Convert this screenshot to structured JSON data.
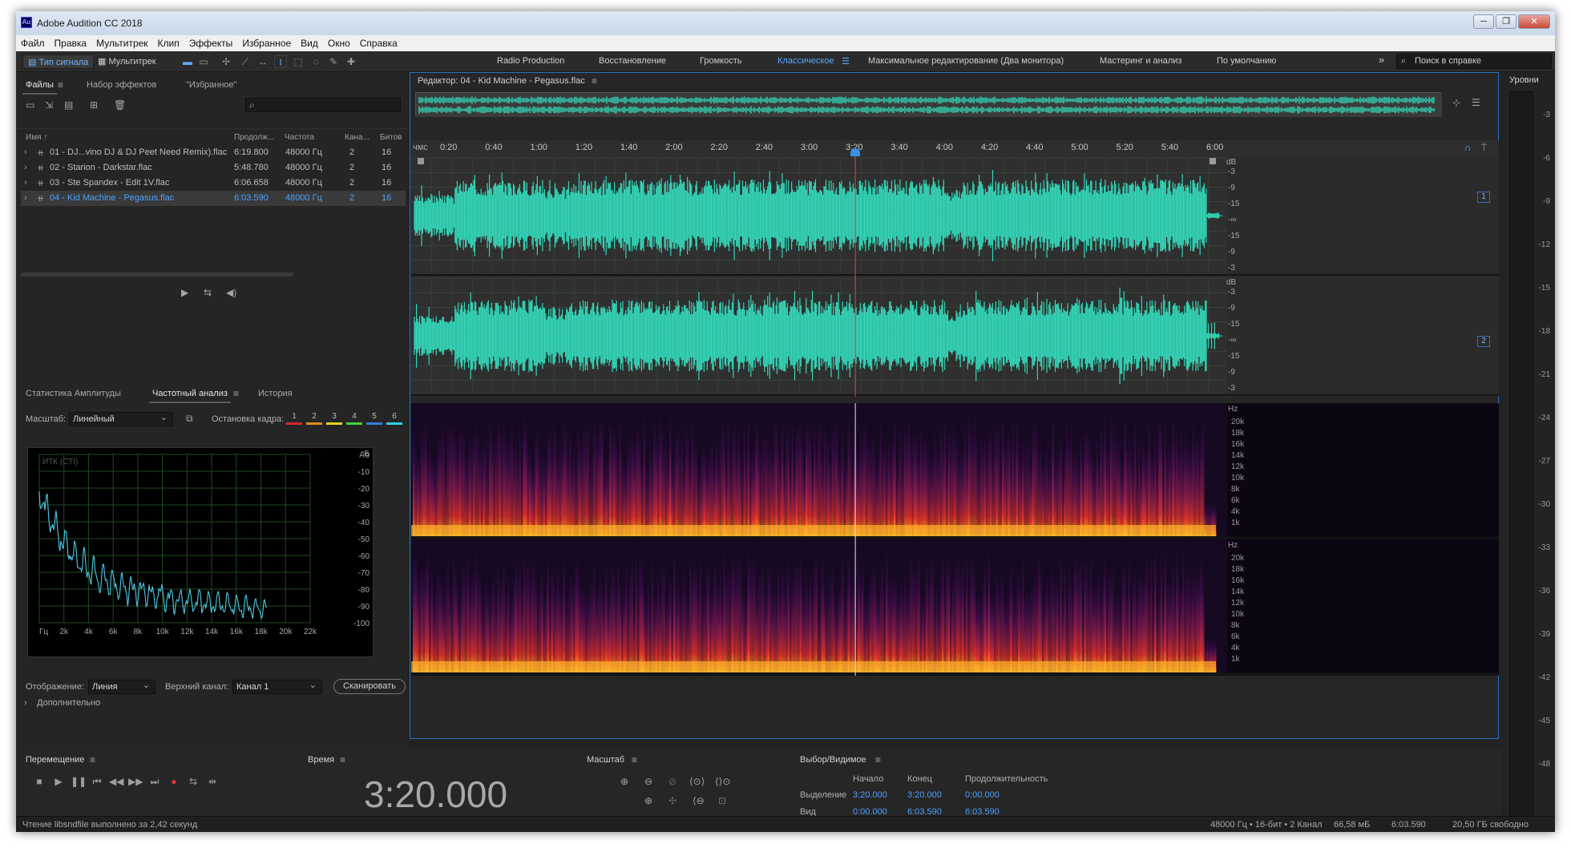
{
  "window": {
    "title": "Adobe Audition CC 2018",
    "app_icon": "Au",
    "buttons": [
      "─",
      "❐",
      "✕"
    ]
  },
  "menu": [
    "Файл",
    "Правка",
    "Мультитрек",
    "Клип",
    "Эффекты",
    "Избранное",
    "Вид",
    "Окно",
    "Справка"
  ],
  "toolbar": {
    "waveform_label": "Тип сигнала",
    "multitrack_label": "Мультитрек",
    "workspaces": [
      "Radio Production",
      "Восстановление",
      "Громкость",
      "Классическое",
      "Максимальное редактирование (Два монитора)",
      "Мастеринг и анализ",
      "По умолчанию"
    ],
    "active_workspace": 3,
    "more": "»",
    "help_placeholder": "Поиск в справке"
  },
  "files_panel": {
    "tabs": [
      "Файлы",
      "Набор эффектов",
      "\"Избранное\""
    ],
    "columns": [
      "Имя ↑",
      "Продолж...",
      "Частота",
      "Кана...",
      "Битов"
    ],
    "rows": [
      {
        "name": "01 - DJ...vino DJ & DJ Peet Need Remix).flac",
        "duration": "6:19.800",
        "rate": "48000 Гц",
        "channels": "2",
        "bits": "16"
      },
      {
        "name": "02 - Starion - Darkstar.flac",
        "duration": "5:48.780",
        "rate": "48000 Гц",
        "channels": "2",
        "bits": "16"
      },
      {
        "name": "03 - Ste Spandex - Edit 1V.flac",
        "duration": "6:06.658",
        "rate": "48000 Гц",
        "channels": "2",
        "bits": "16"
      },
      {
        "name": "04 - Kid Machine - Pegasus.flac",
        "duration": "6:03.590",
        "rate": "48000 Гц",
        "channels": "2",
        "bits": "16"
      }
    ],
    "selected_row": 3
  },
  "analysis_panel": {
    "tabs": [
      "Статистика Амплитуды",
      "Частотный анализ",
      "История"
    ],
    "scale_label": "Масштаб:",
    "scale_value": "Линейный",
    "freeze_label": "Остановка кадра:",
    "freeze_buttons": [
      "1",
      "2",
      "3",
      "4",
      "5",
      "6"
    ],
    "freeze_colors": [
      "#d22828",
      "#e08a1e",
      "#e0d21e",
      "#3fd23f",
      "#2f7fe0",
      "#2fd0e0"
    ],
    "graph_label": "ИТК (СТI)",
    "db_unit": "дБ",
    "db_ticks": [
      "0",
      "-10",
      "-20",
      "-30",
      "-40",
      "-50",
      "-60",
      "-70",
      "-80",
      "-90",
      "-100"
    ],
    "hz_ticks": [
      "Гц",
      "2k",
      "4k",
      "6k",
      "8k",
      "10k",
      "12k",
      "14k",
      "16k",
      "18k",
      "20k",
      "22k"
    ],
    "display_label": "Отображение:",
    "display_value": "Линия",
    "channel_label": "Верхний канал:",
    "channel_value": "Канал 1",
    "scan_button": "Сканировать",
    "advanced_label": "Дополнительно",
    "curve_color": "#4ec8e8"
  },
  "editor": {
    "title": "Редактор: 04 - Kid Machine - Pegasus.flac",
    "ruler_unit": "чмс",
    "ruler_ticks": [
      "0:20",
      "0:40",
      "1:00",
      "1:20",
      "1:40",
      "2:00",
      "2:20",
      "2:40",
      "3:00",
      "3:20",
      "3:40",
      "4:00",
      "4:20",
      "4:40",
      "5:00",
      "5:20",
      "5:40",
      "6:00"
    ],
    "playhead_time": "3:20.000",
    "wave_color": "#33d6b8",
    "db_unit": "dB",
    "db_ticks": [
      "-3",
      "-9",
      "-15",
      "-∞",
      "-15",
      "-9",
      "-3"
    ],
    "hz_unit": "Hz",
    "hz_ticks": [
      "20k",
      "18k",
      "16k",
      "14k",
      "12k",
      "10k",
      "8k",
      "6k",
      "4k",
      "1k"
    ],
    "channels": [
      "1",
      "2"
    ]
  },
  "levels": {
    "title": "Уровни",
    "ticks": [
      "-3",
      "-6",
      "-9",
      "-12",
      "-15",
      "-18",
      "-21",
      "-24",
      "-27",
      "-30",
      "-33",
      "-36",
      "-39",
      "-42",
      "-45",
      "-48"
    ]
  },
  "transport": {
    "title": "Перемещение",
    "buttons": [
      "■",
      "▶",
      "❚❚",
      "⏮",
      "◀◀",
      "▶▶",
      "⏭",
      "●",
      "⇆",
      "⇹"
    ]
  },
  "time": {
    "title": "Время",
    "value": "3:20.000"
  },
  "zoom": {
    "title": "Масштаб"
  },
  "selection": {
    "title": "Выбор/Видимое",
    "columns": [
      "Начало",
      "Конец",
      "Продолжительность"
    ],
    "rows": [
      {
        "label": "Выделение",
        "start": "3:20.000",
        "end": "3:20.000",
        "duration": "0:00.000"
      },
      {
        "label": "Вид",
        "start": "0:00.000",
        "end": "6:03.590",
        "duration": "6:03.590"
      }
    ]
  },
  "status": {
    "message": "Чтение libsndfile выполнено за 2,42 секунд",
    "format": "48000 Гц • 16-бит • 2 Канал",
    "size": "66,58 мБ",
    "duration": "6:03.590",
    "free": "20,50 ГБ свободно"
  }
}
